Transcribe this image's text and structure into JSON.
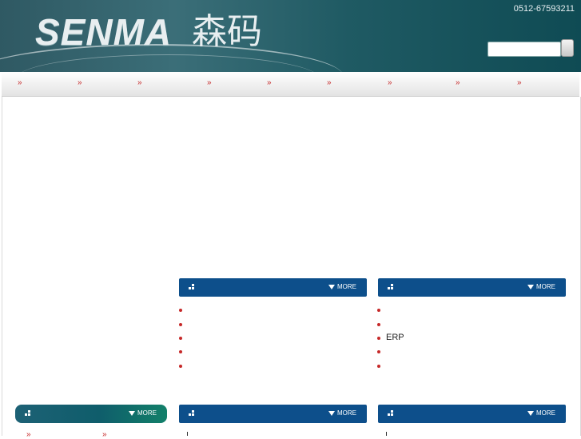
{
  "header": {
    "logo_text": "SENMA",
    "logo_cn": "森码",
    "phone": "0512-67593211",
    "search": {
      "placeholder": ""
    }
  },
  "nav": {
    "items": [
      {
        "label": "»"
      },
      {
        "label": "»"
      },
      {
        "label": "»"
      },
      {
        "label": "»"
      },
      {
        "label": "»"
      },
      {
        "label": "»"
      },
      {
        "label": "»"
      },
      {
        "label": "»"
      },
      {
        "label": "»"
      }
    ]
  },
  "panels": [
    {
      "more_label": "MORE",
      "items": [
        "",
        "",
        "",
        "",
        ""
      ]
    },
    {
      "more_label": "MORE",
      "items": [
        "",
        "",
        "ERP",
        "",
        ""
      ]
    },
    {
      "more_label": "MORE",
      "items": [
        "»",
        "»"
      ]
    },
    {
      "more_label": "MORE",
      "items": []
    },
    {
      "more_label": "MORE",
      "items": []
    }
  ],
  "colors": {
    "header_bg": "#1f5a63",
    "panel_blue": "#0d4f8b",
    "accent_red": "#c62828"
  }
}
